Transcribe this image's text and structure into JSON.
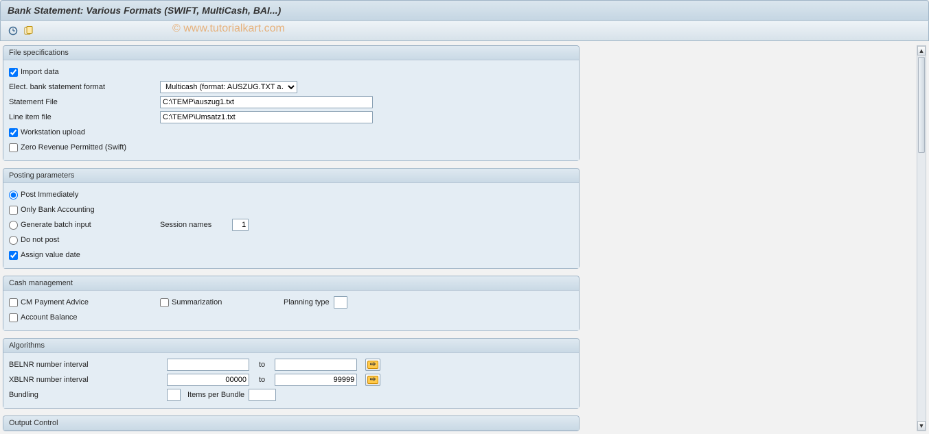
{
  "title": "Bank Statement: Various Formats (SWIFT, MultiCash, BAI...)",
  "watermark": "© www.tutorialkart.com",
  "groups": {
    "file_spec": {
      "title": "File specifications",
      "import_data": "Import data",
      "format_label": "Elect. bank statement format",
      "format_value": "Multicash (format: AUSZUG.TXT a…",
      "stmt_file_label": "Statement File",
      "stmt_file_value": "C:\\TEMP\\auszug1.txt",
      "line_file_label": "Line item file",
      "line_file_value": "C:\\TEMP\\Umsatz1.txt",
      "ws_upload": "Workstation upload",
      "zero_rev": "Zero Revenue Permitted (Swift)"
    },
    "posting": {
      "title": "Posting parameters",
      "post_immediately": "Post Immediately",
      "only_bank": "Only Bank Accounting",
      "gen_batch": "Generate batch input",
      "session_names": "Session names",
      "session_value": "1",
      "do_not_post": "Do not post",
      "assign_value_date": "Assign value date"
    },
    "cash": {
      "title": "Cash management",
      "cm_advice": "CM Payment Advice",
      "summarization": "Summarization",
      "planning_type": "Planning type",
      "account_balance": "Account Balance"
    },
    "alg": {
      "title": "Algorithms",
      "belnr": "BELNR number interval",
      "xblnr": "XBLNR number interval",
      "to": "to",
      "xblnr_from": "00000",
      "xblnr_to": "99999",
      "bundling": "Bundling",
      "items_per_bundle": "Items per Bundle"
    },
    "output": {
      "title": "Output Control"
    }
  }
}
